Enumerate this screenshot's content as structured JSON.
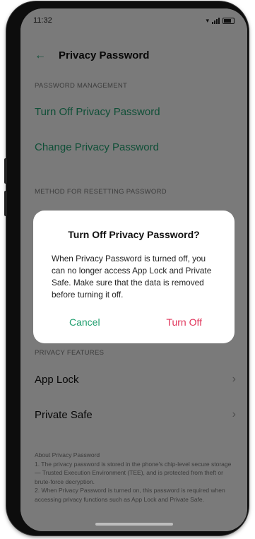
{
  "status_bar": {
    "time": "11:32"
  },
  "header": {
    "back_icon": "back-arrow-icon",
    "title": "Privacy Password"
  },
  "password_management": {
    "section_label": "PASSWORD MANAGEMENT",
    "turn_off_label": "Turn Off Privacy Password",
    "change_label": "Change Privacy Password"
  },
  "reset_method": {
    "section_label": "METHOD FOR RESETTING PASSWORD"
  },
  "privacy_features": {
    "section_label": "PRIVACY FEATURES",
    "items": [
      {
        "label": "App Lock"
      },
      {
        "label": "Private Safe"
      }
    ]
  },
  "about": {
    "title": "About Privacy Password",
    "line1": "1. The privacy password is stored in the phone's chip-level secure storage — Trusted Execution Environment (TEE), and is protected from theft or brute-force decryption.",
    "line2": "2. When Privacy Password is turned on, this password is required when accessing privacy functions such as App Lock and Private Safe."
  },
  "dialog": {
    "title": "Turn Off Privacy Password?",
    "message": "When Privacy Password is turned off, you can no longer access App Lock and Private Safe. Make sure that the data is removed before turning it off.",
    "cancel_label": "Cancel",
    "confirm_label": "Turn Off"
  },
  "colors": {
    "accent": "#1f9e6e",
    "danger": "#e0345a",
    "scrim": "rgba(0,0,0,0.5)"
  }
}
